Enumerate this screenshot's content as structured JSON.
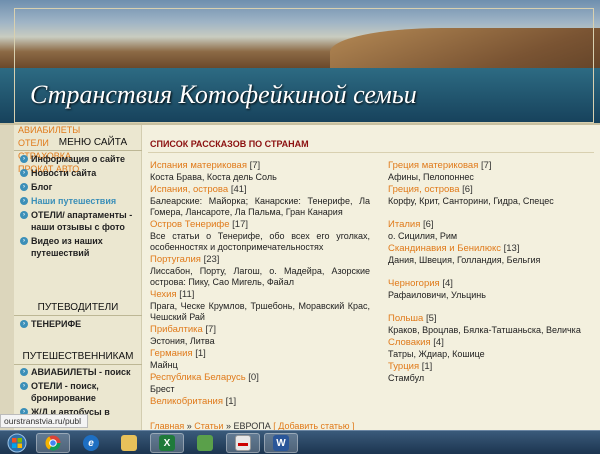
{
  "header": {
    "title": "Странствия Котофейкиной семьи"
  },
  "sidebar": {
    "top_links": [
      "АВИАБИЛЕТЫ",
      "ОТЕЛИ",
      "СТРАХОВКА",
      "ПРОКАТ АВТО"
    ],
    "menu_title": "МЕНЮ САЙТА",
    "menu": [
      "Информация о сайте",
      "Новости сайта",
      "Блог",
      "Наши путешествия",
      "ОТЕЛИ/ апартаменты - наши отзывы с фото",
      "Видео из наших путешествий"
    ],
    "guides_title": "ПУТЕВОДИТЕЛИ",
    "guides": [
      "ТЕНЕРИФЕ"
    ],
    "travelers_title": "ПУТЕШЕСТВЕННИКАМ",
    "travelers": [
      "АВИАБИЛЕТЫ - поиск",
      "ОТЕЛИ - поиск, бронирование",
      "Ж/Д и автобусы в"
    ]
  },
  "main": {
    "title": "СПИСОК РАССКАЗОВ ПО СТРАНАМ",
    "left": [
      {
        "name": "Испания материковая",
        "count": "[7]",
        "desc": "Коста Брава, Коста дель Соль"
      },
      {
        "name": "Испания, острова",
        "count": "[41]",
        "desc": "Балеарские: Майорка; Канарские: Тенерифе, Ла Гомера, Лансароте, Ла Пальма, Гран Канария"
      },
      {
        "name": "Остров Тенерифе",
        "count": "[17]",
        "desc": "Все статьи о Тенерифе, обо всех его уголках, особенностях и достопримечательностях"
      },
      {
        "name": "Португалия",
        "count": "[23]",
        "desc": "Лиссабон, Порту, Лагош, о. Мадейра, Азорские острова: Пику, Сао Мигель, Файал"
      },
      {
        "name": "Чехия",
        "count": "[11]",
        "desc": "Прага, Ческе Крумлов, Тршебонь, Моравский Крас, Чешский Рай"
      },
      {
        "name": "Прибалтика",
        "count": "[7]",
        "desc": "Эстония, Литва"
      },
      {
        "name": "Германия",
        "count": "[1]",
        "desc": "Майнц"
      },
      {
        "name": "Республика Беларусь",
        "count": "[0]",
        "desc": "Брест"
      },
      {
        "name": "Великобритания",
        "count": "[1]",
        "desc": ""
      }
    ],
    "right": [
      {
        "name": "Греция материковая",
        "count": "[7]",
        "desc": "Афины, Пелопоннес"
      },
      {
        "name": "Греция, острова",
        "count": "[6]",
        "desc": "Корфу, Крит, Санторини, Гидра, Спецес"
      },
      {
        "name": "Италия",
        "count": "[6]",
        "desc": "о. Сицилия, Рим"
      },
      {
        "name": "Скандинавия и Бенилюкс",
        "count": "[13]",
        "desc": "Дания, Швеция, Голландия, Бельгия"
      },
      {
        "name": "Черногория",
        "count": "[4]",
        "desc": "Рафаиловичи, Ульцинь"
      },
      {
        "name": "Польша",
        "count": "[5]",
        "desc": "Краков, Вроцлав, Бялка-Татшаньска, Величка"
      },
      {
        "name": "Словакия",
        "count": "[4]",
        "desc": "Татры, Ждиар, Кошице"
      },
      {
        "name": "Турция",
        "count": "[1]",
        "desc": "Стамбул"
      }
    ],
    "breadcrumb": {
      "home": "Главная",
      "sep": " » ",
      "articles": "Статьи",
      "current": "ЕВРОПА",
      "add": "[ Добавить статью ]"
    }
  },
  "statusbar": {
    "url": "ourstranstvia.ru/publ"
  },
  "taskbar": {
    "apps": [
      "start",
      "chrome",
      "ie",
      "explorer",
      "excel",
      "picture",
      "pdf",
      "word"
    ]
  },
  "colors": {
    "link": "#e07a1a",
    "title": "#8b1010",
    "accent": "#3b8fb8"
  }
}
